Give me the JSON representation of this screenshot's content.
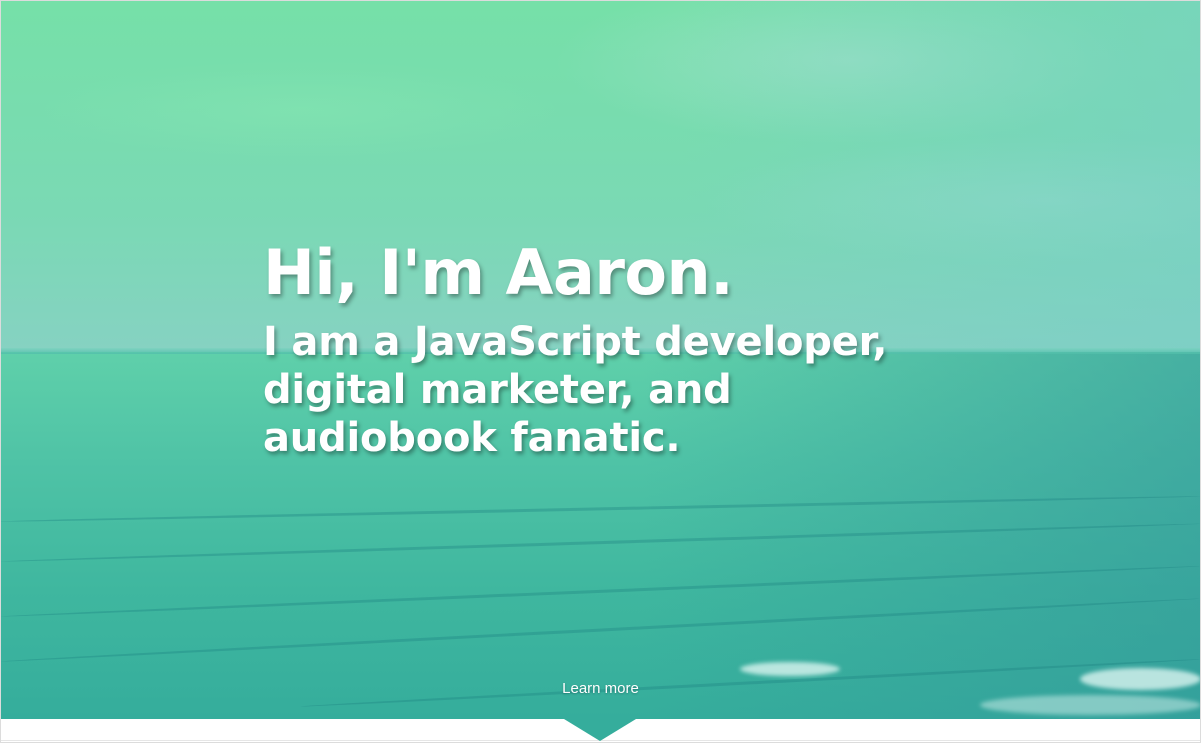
{
  "hero": {
    "headline": "Hi, I'm Aaron.",
    "tagline": "I am a JavaScript developer, digital marketer, and audiobook fanatic.",
    "learn_more_label": "Learn more",
    "scroll_icon": "triangle-down-icon"
  },
  "colors": {
    "gradient_start": "#6fe3a2",
    "gradient_end": "#35ad9c",
    "text": "#ffffff"
  }
}
